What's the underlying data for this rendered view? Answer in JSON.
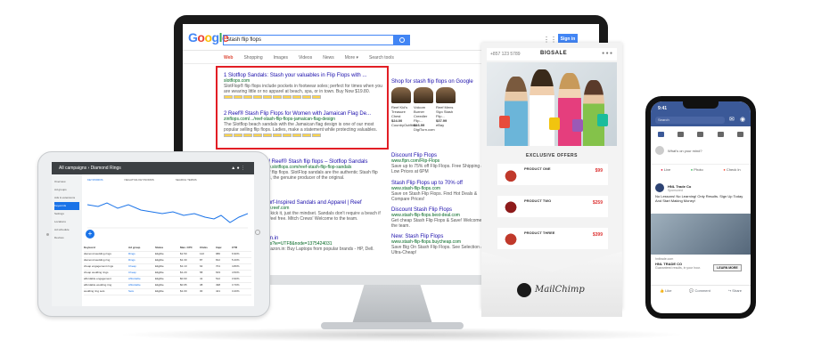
{
  "google": {
    "logo": "Google",
    "query": "stash flip flops",
    "signin": "Sign in",
    "tabs": [
      "Web",
      "Shopping",
      "Images",
      "Videos",
      "News",
      "More ▾",
      "Search tools"
    ],
    "results": [
      {
        "title": "1 Slotflop Sandals: Stash your valuables in Flip Flops with ...",
        "url": "slotflops.com",
        "desc": "SlotFlop® flip flops include pockets in footwear soles; perfect for times when you are wearing little or no apparel at beach, spa, or in town. Buy Now $19.80."
      },
      {
        "title": "2 Reef® Stash Flip Flops for Women with Jamaican Flag De...",
        "url": "zinflops.com/.../reef-stash-flip-flops-jamaican-flag-design",
        "desc": "The Slotflop beach sandals with the Jamaican flag design is one of our most popular selling flip flops. Ladies, make a statement while protecting valuables."
      },
      {
        "title": "and Reef® Stash flip flops – Slotflop Sandals",
        "url": "www.slotflops.com/reef-stash-flip-flop-sandals",
        "desc": "Reef flip flops. SlotFlop sandals are the authentic Stash flip flops, the genuine producer of the original."
      },
      {
        "title": "- Surf-Inspired Sandals and Apparel | Reef",
        "url": "www.reef.com",
        "desc": "Just kick it, just the mindset. Sandals don't require a beach if just feel free. Mitch Crews' Welcome to the team."
      },
      {
        "title": "azon.in",
        "url": "ptops?ie=UTF8&node=1375424031",
        "desc": "- Amazon.in: Buy Laptops from popular brands - HP, Dell."
      }
    ],
    "shopping_title": "Shop for stash flip flops on Google",
    "products": [
      {
        "name": "Reef Kid's Treasure Chest",
        "price": "$24.00",
        "store": "CountryOutfitter"
      },
      {
        "name": "Volcom Burner Creedler Flip...",
        "price": "$16.99",
        "store": "DigiTurn.com"
      },
      {
        "name": "Reef Mens Slyo Stash Flip...",
        "price": "$37.99",
        "store": "eBay"
      }
    ],
    "ads": [
      {
        "title": "Discount Flip Flops",
        "url": "www.flpn.com/Flip-Flops",
        "desc": "Save up to 75% off Flip Flops. Free Shipping & Low Prices at 6PM"
      },
      {
        "title": "Stash Flip Flops up to 70% off",
        "url": "www.stash-flip-flops.com",
        "desc": "Save on Stash Flip Flops. Find Hot Deals & Compare Prices!"
      },
      {
        "title": "Discount Stash Flip Flops",
        "url": "www.stash-flip-flops.best-deal.com",
        "desc": "Get cheap Stash Flip Flops & Save! Welcome to the team."
      },
      {
        "title": "New: Stash Flip Flops",
        "url": "www.stash-flip-flops.buycheap.com",
        "desc": "Save Big On Stash Flip Flops. See Selection & Ultra-Cheap!"
      }
    ]
  },
  "email": {
    "phone": "+857 123 5789",
    "brand": "BIGSALE",
    "offers_title": "EXCLUSIVE OFFERS",
    "offers": [
      {
        "name": "PRODUCT ONE",
        "price": "$99"
      },
      {
        "name": "PRODUCT TWO",
        "price": "$259"
      },
      {
        "name": "PRODUCT THREE",
        "price": "$399"
      }
    ],
    "logo_text": "MailChimp",
    "colors": {
      "price": "#dd3333",
      "hero": "#c8d2d8"
    }
  },
  "tablet": {
    "title": "All campaigns › Diamond Rings",
    "tabs": [
      "KEYWORDS",
      "NEGATIVE KEYWORDS",
      "SEARCH TERMS"
    ],
    "sidebar": [
      "Overview",
      "Ad groups",
      "Ads & extensions",
      "Keywords",
      "Settings",
      "Locations",
      "Ad schedule",
      "Devices"
    ],
    "active_sidebar": "Keywords",
    "table_header": [
      "Keyword",
      "Ad group",
      "Status",
      "Max. CPC",
      "Clicks",
      "Impr.",
      "CTR"
    ],
    "rows": [
      [
        "diamond wedding rings",
        "Rings",
        "Eligible",
        "$1.50",
        "122",
        "980",
        "6.90%"
      ],
      [
        "diamond wedding ring",
        "Rings",
        "Eligible",
        "$1.30",
        "87",
        "812",
        "5.20%"
      ],
      [
        "cheap engagement rings",
        "Cheap",
        "Eligible",
        "$1.10",
        "64",
        "701",
        "4.80%"
      ],
      [
        "cheap wedding rings",
        "Cheap",
        "Eligible",
        "$1.20",
        "58",
        "633",
        "4.50%"
      ],
      [
        "affordable engagement",
        "Affordable",
        "Eligible",
        "$0.90",
        "41",
        "512",
        "3.90%"
      ],
      [
        "affordable wedding ring",
        "Affordable",
        "Eligible",
        "$0.95",
        "38",
        "498",
        "3.70%"
      ],
      [
        "wedding ring sets",
        "Sets",
        "Eligible",
        "$1.00",
        "30",
        "421",
        "3.20%"
      ]
    ]
  },
  "phone": {
    "time": "9:41",
    "search": "Search",
    "status": "What's on your mind?",
    "post_actions": [
      "Live",
      "Photo",
      "Check In"
    ],
    "advertiser": "HNL Trade Co",
    "sponsored": "Sponsored",
    "ad_text": "No Lessons! No Learning! Only Results. Sign Up Today And Start Making Money!",
    "link_domain": "hnltrade.com",
    "link_title": "HNL TRADE CO",
    "link_sub": "Guaranteed results, in your hour.",
    "cta": "LEARN MORE",
    "actions": [
      "Like",
      "Comment",
      "Share"
    ],
    "brand_color": "#3b5998"
  }
}
